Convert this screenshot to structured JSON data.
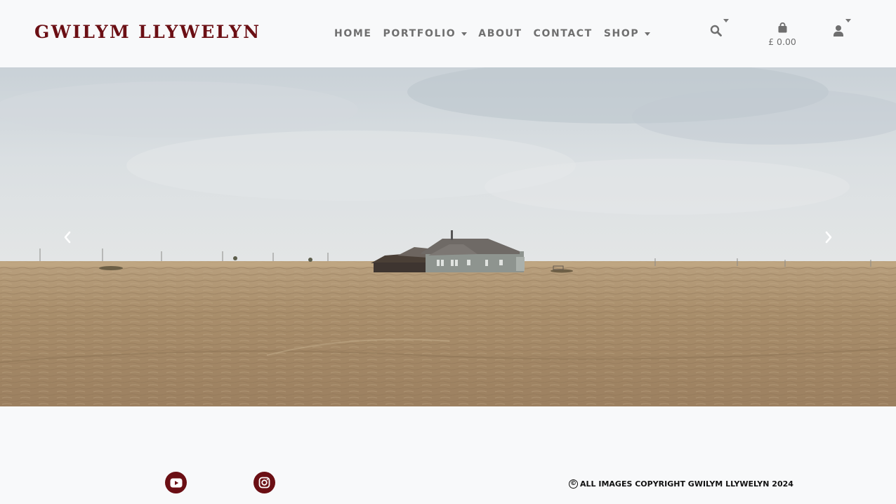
{
  "brand": {
    "name": "GWILYM LLYWELYN",
    "color": "#6b0f14"
  },
  "nav": {
    "items": [
      {
        "label": "HOME",
        "dropdown": false
      },
      {
        "label": "PORTFOLIO",
        "dropdown": true
      },
      {
        "label": "ABOUT",
        "dropdown": false
      },
      {
        "label": "CONTACT",
        "dropdown": false
      },
      {
        "label": "SHOP",
        "dropdown": true
      }
    ],
    "search_icon": "search-icon",
    "cart": {
      "icon": "shopping-bag-icon",
      "total": "£ 0.00"
    },
    "user_icon": "user-icon"
  },
  "hero": {
    "image": "prairie field with lone farmhouse under overcast sky",
    "prev_icon": "chevron-left-icon",
    "next_icon": "chevron-right-icon"
  },
  "footer": {
    "social": [
      {
        "icon": "youtube-icon"
      },
      {
        "icon": "instagram-icon"
      }
    ],
    "copyright_symbol": "©",
    "copyright": "ALL IMAGES COPYRIGHT GWILYM LLYWELYN 2024"
  },
  "colors": {
    "accent": "#6b0f14",
    "nav_text": "#6f6f6f",
    "background": "#f8f9fa"
  }
}
